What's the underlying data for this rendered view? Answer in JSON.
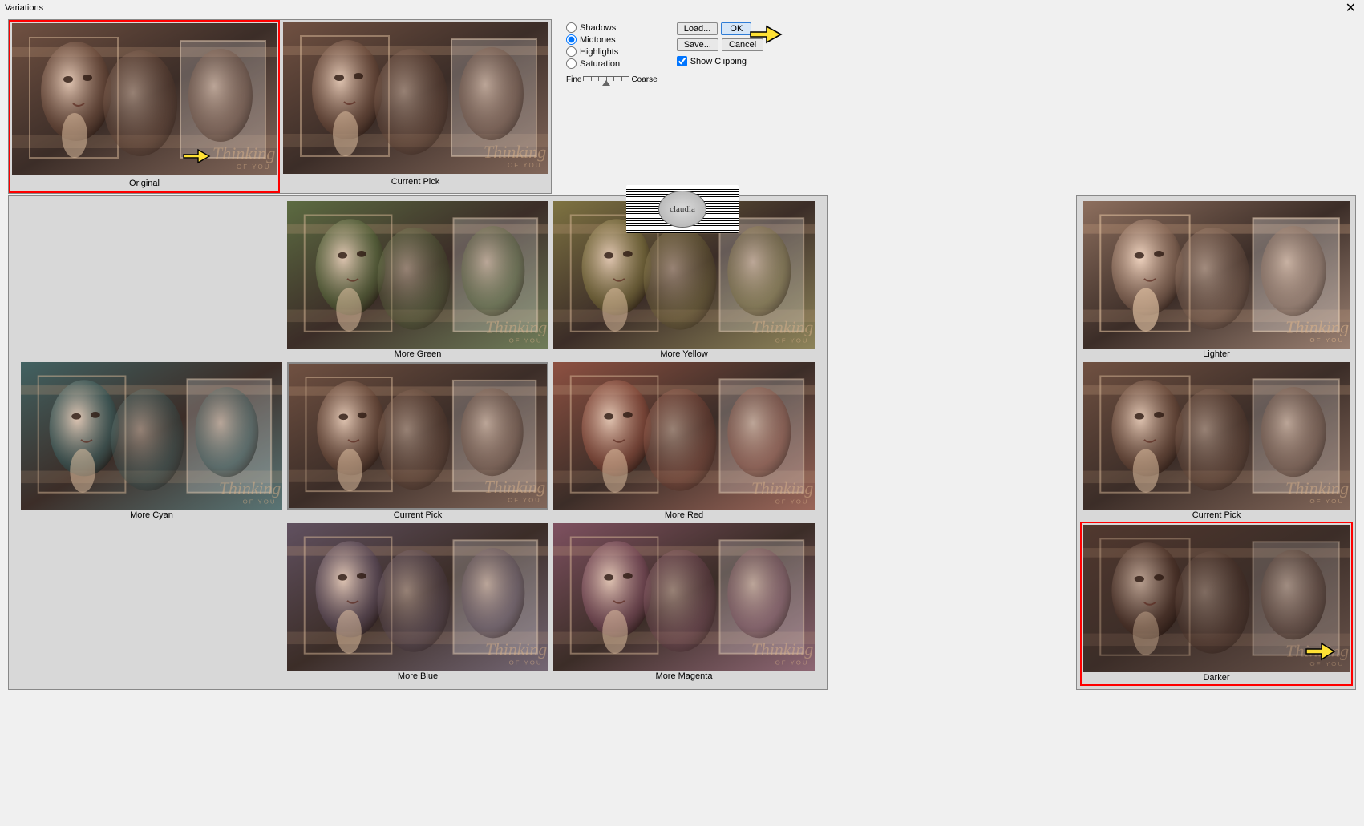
{
  "dialog_title": "Variations",
  "top_previews": {
    "original_label": "Original",
    "current_label": "Current Pick"
  },
  "radios": {
    "shadows": "Shadows",
    "midtones": "Midtones",
    "highlights": "Highlights",
    "saturation": "Saturation",
    "selected": "Midtones"
  },
  "slider": {
    "left_label": "Fine",
    "right_label": "Coarse"
  },
  "buttons": {
    "load": "Load...",
    "ok": "OK",
    "save": "Save...",
    "cancel": "Cancel"
  },
  "show_clipping_label": "Show Clipping",
  "show_clipping_checked": true,
  "color_grid": [
    {
      "label": "",
      "tint": "none"
    },
    {
      "label": "More Green",
      "tint": "#56663a"
    },
    {
      "label": "More Yellow",
      "tint": "#7a6e3a"
    },
    {
      "label": "More Cyan",
      "tint": "#3a5c5c"
    },
    {
      "label": "Current Pick",
      "tint": "#6b4a3a",
      "center": true
    },
    {
      "label": "More Red",
      "tint": "#8a4a3a"
    },
    {
      "label": "",
      "tint": "none"
    },
    {
      "label": "More Blue",
      "tint": "#5b4a5a"
    },
    {
      "label": "More Magenta",
      "tint": "#7a4a5a"
    }
  ],
  "tone_col": [
    {
      "label": "Lighter",
      "tint": "#8a6a58",
      "bright": 1.25
    },
    {
      "label": "Current Pick",
      "tint": "#6b4a3a",
      "bright": 1.0
    },
    {
      "label": "Darker",
      "tint": "#4a3026",
      "bright": 0.75,
      "highlight": true
    }
  ],
  "watermark_text": "claudia",
  "icons": {
    "close": "✕"
  }
}
